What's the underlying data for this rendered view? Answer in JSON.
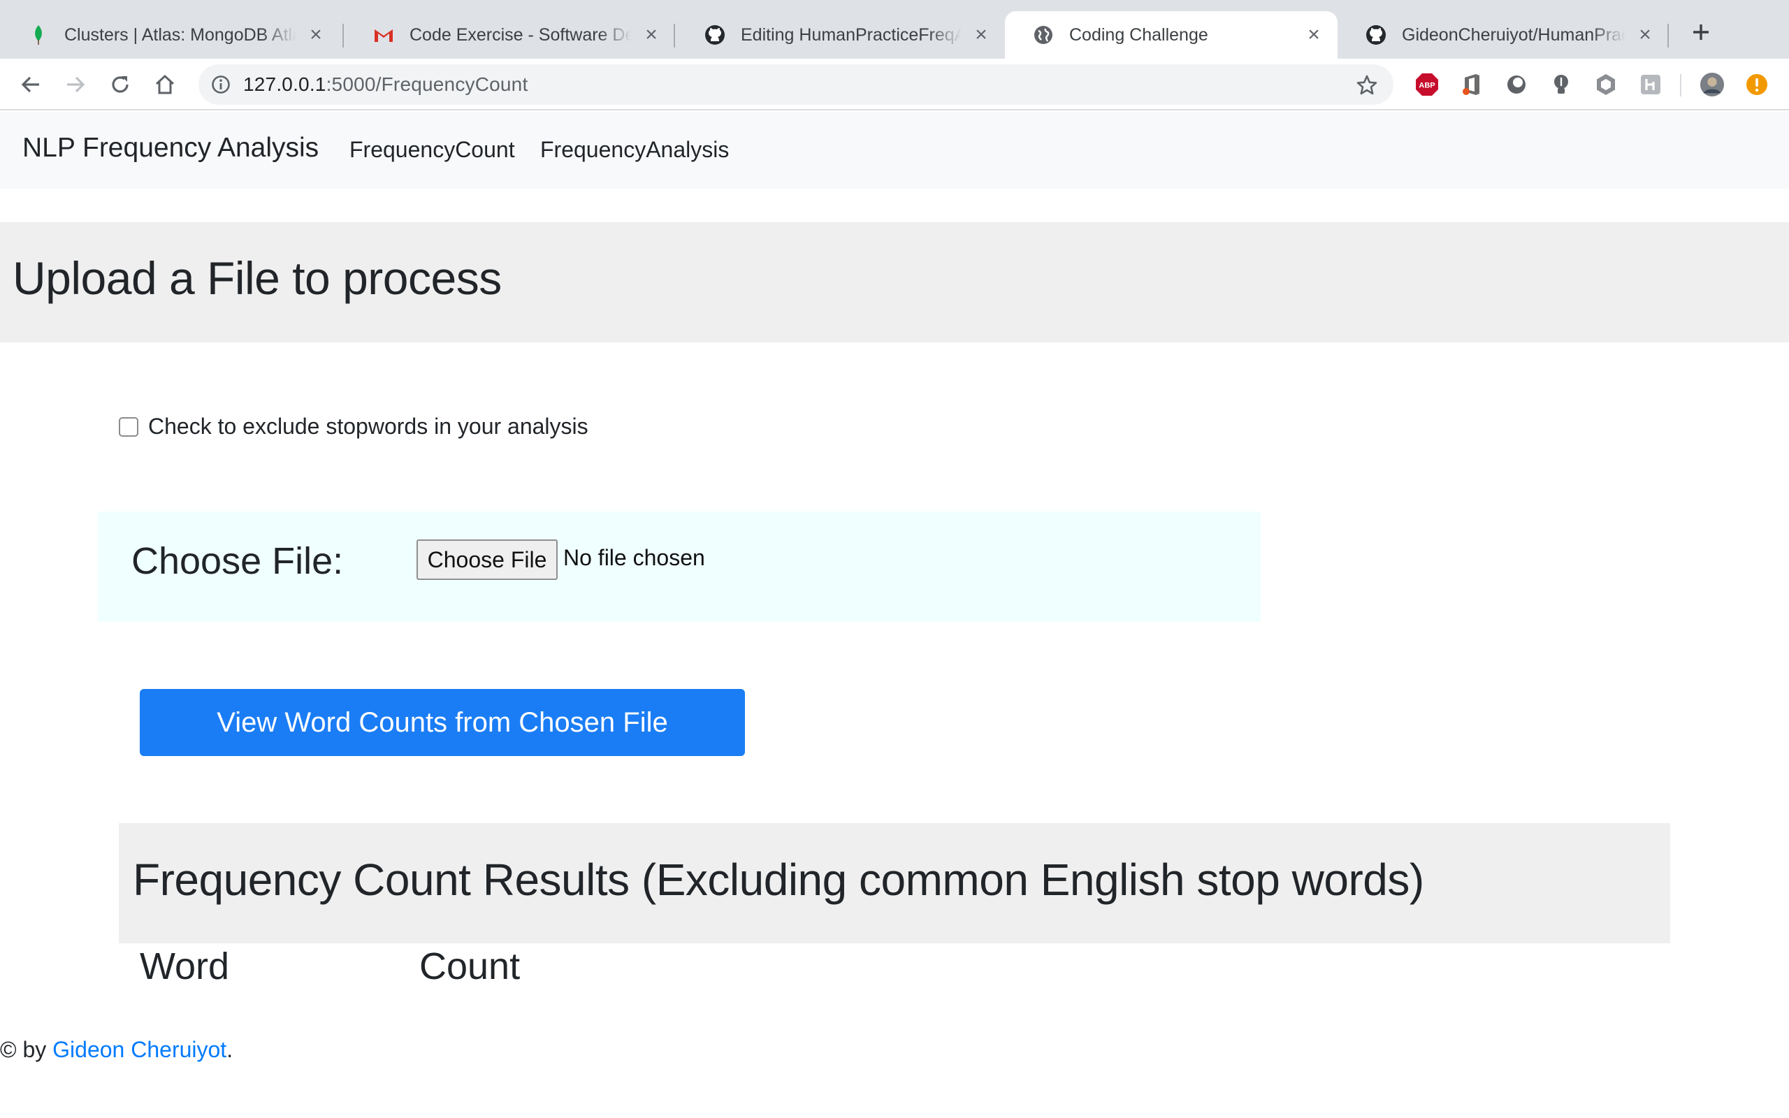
{
  "browser": {
    "tabs": [
      {
        "title": "Clusters | Atlas: MongoDB Atlas",
        "icon": "mongodb-leaf-icon",
        "active": false
      },
      {
        "title": "Code Exercise - Software Developer",
        "icon": "gmail-icon",
        "active": false
      },
      {
        "title": "Editing HumanPracticeFreqAnalysis",
        "icon": "github-icon",
        "active": false
      },
      {
        "title": "Coding Challenge",
        "icon": "globe-icon",
        "active": true
      },
      {
        "title": "GideonCheruiyot/HumanPracticeFreqAnalysis",
        "icon": "github-icon",
        "active": false
      }
    ],
    "url_host": "127.0.0.1",
    "url_path": ":5000/FrequencyCount",
    "extensions": [
      "adblock-plus-icon",
      "office-icon",
      "circle-extension-icon",
      "bulb-extension-icon",
      "hexagon-extension-icon",
      "h-extension-icon"
    ]
  },
  "navbar": {
    "brand": "NLP Frequency Analysis",
    "links": [
      "FrequencyCount",
      "FrequencyAnalysis"
    ]
  },
  "jumbotron": {
    "title": "Upload a File to process"
  },
  "form": {
    "checkbox_label": "Check to exclude stopwords in your analysis",
    "checkbox_checked": false,
    "file_label": "Choose File:",
    "file_button": "Choose File",
    "file_status": "No file chosen",
    "submit_label": "View Word Counts from Chosen File"
  },
  "results": {
    "title": "Frequency Count Results (Excluding common English stop words)",
    "columns": [
      "Word",
      "Count"
    ]
  },
  "footer": {
    "prefix": "© by ",
    "author": "Gideon Cheruiyot",
    "suffix": "."
  },
  "colors": {
    "primary": "#1a7df5",
    "link": "#007bff",
    "file_box_bg": "#f0ffff",
    "section_bg": "#efefef"
  }
}
